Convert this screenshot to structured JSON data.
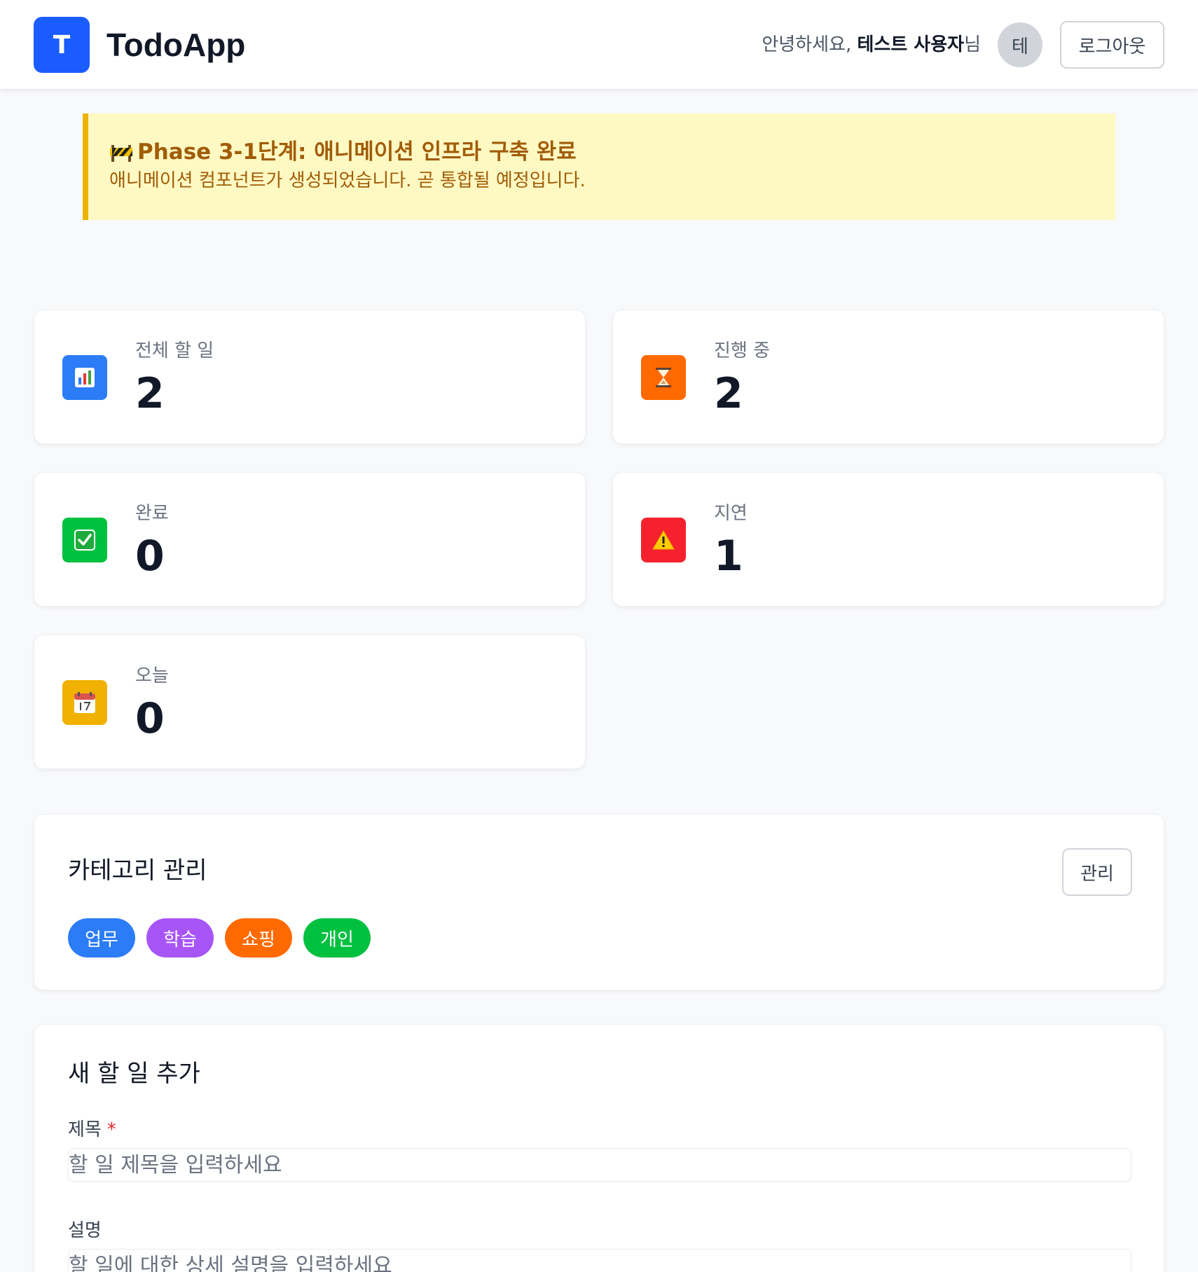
{
  "header": {
    "logo_letter": "T",
    "app_name": "TodoApp",
    "greeting_prefix": "안녕하세요, ",
    "user_name": "테스트 사용자",
    "greeting_suffix": "님",
    "avatar_letter": "테",
    "logout_label": "로그아웃"
  },
  "banner": {
    "icon": "construction-icon",
    "title": "Phase 3-1단계: 애니메이션 인프라 구축 완료",
    "text": "애니메이션 컴포넌트가 생성되었습니다. 곧 통합될 예정입니다.",
    "accent": "#eab308"
  },
  "stats": [
    {
      "label": "전체 할 일",
      "value": "2",
      "icon": "bar-chart-icon",
      "color": "#2b7cf6"
    },
    {
      "label": "진행 중",
      "value": "2",
      "icon": "hourglass-icon",
      "color": "#ff6a00"
    },
    {
      "label": "완료",
      "value": "0",
      "icon": "check-icon",
      "color": "#00c040"
    },
    {
      "label": "지연",
      "value": "1",
      "icon": "warning-icon",
      "color": "#f5222d"
    },
    {
      "label": "오늘",
      "value": "0",
      "icon": "calendar-icon",
      "color": "#f0b100"
    }
  ],
  "categories": {
    "title": "카테고리 관리",
    "manage_label": "관리",
    "items": [
      {
        "label": "업무",
        "color": "#2b7cf6"
      },
      {
        "label": "학습",
        "color": "#a855f7"
      },
      {
        "label": "쇼핑",
        "color": "#ff6a00"
      },
      {
        "label": "개인",
        "color": "#00c040"
      }
    ]
  },
  "new_todo": {
    "title": "새 할 일 추가",
    "title_label": "제목",
    "required_mark": "*",
    "title_placeholder": "할 일 제목을 입력하세요",
    "description_label": "설명",
    "description_placeholder": "할 일에 대한 상세 설명을 입력하세요"
  }
}
